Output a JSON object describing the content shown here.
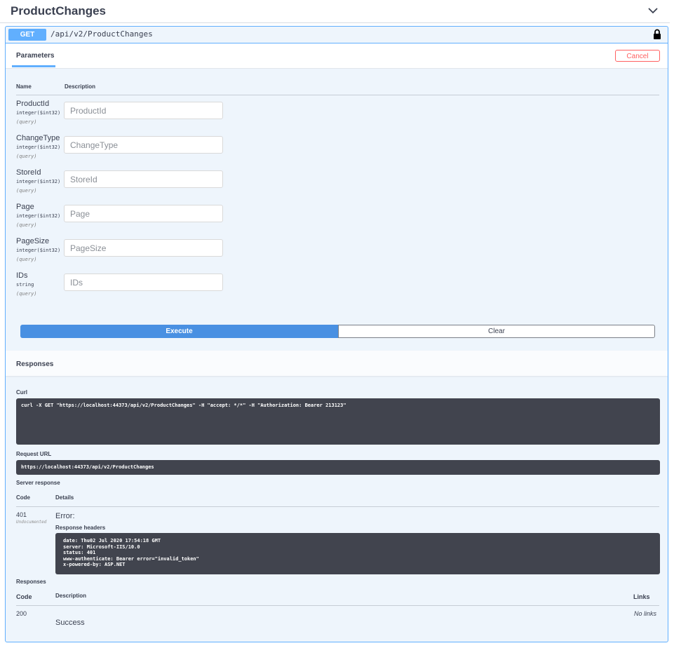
{
  "section": {
    "title": "ProductChanges"
  },
  "operation": {
    "method": "GET",
    "path": "/api/v2/ProductChanges"
  },
  "parameters": {
    "tab_label": "Parameters",
    "cancel_label": "Cancel",
    "col_name": "Name",
    "col_description": "Description",
    "items": [
      {
        "name": "ProductId",
        "type": "integer($int32)",
        "in": "(query)",
        "placeholder": "ProductId"
      },
      {
        "name": "ChangeType",
        "type": "integer($int32)",
        "in": "(query)",
        "placeholder": "ChangeType"
      },
      {
        "name": "StoreId",
        "type": "integer($int32)",
        "in": "(query)",
        "placeholder": "StoreId"
      },
      {
        "name": "Page",
        "type": "integer($int32)",
        "in": "(query)",
        "placeholder": "Page"
      },
      {
        "name": "PageSize",
        "type": "integer($int32)",
        "in": "(query)",
        "placeholder": "PageSize"
      },
      {
        "name": "IDs",
        "type": "string",
        "in": "(query)",
        "placeholder": "IDs"
      }
    ]
  },
  "actions": {
    "execute_label": "Execute",
    "clear_label": "Clear"
  },
  "responses": {
    "title": "Responses",
    "curl_label": "Curl",
    "curl_command": "curl -X GET \"https://localhost:44373/api/v2/ProductChanges\" -H \"accept: */*\" -H \"Authorization: Bearer 213123\"",
    "request_url_label": "Request URL",
    "request_url": "https://localhost:44373/api/v2/ProductChanges",
    "server_response_label": "Server response",
    "col_code": "Code",
    "col_details": "Details",
    "server_code": "401",
    "server_code_note": "Undocumented",
    "error_text": "Error:",
    "response_headers_label": "Response headers",
    "headers_text": "date: Thu02 Jul 2020 17:54:18 GMT\nserver: Microsoft-IIS/10.0\nstatus: 401\nwww-authenticate: Bearer error=\"invalid_token\"\nx-powered-by: ASP.NET",
    "documented_label": "Responses",
    "doc_col_code": "Code",
    "doc_col_description": "Description",
    "doc_col_links": "Links",
    "doc_code": "200",
    "doc_description": "Success",
    "doc_links": "No links"
  },
  "colors": {
    "get_blue": "#61affe",
    "execute_blue": "#4990e2",
    "cancel_red": "#ff6060",
    "code_bg": "#41444e"
  },
  "icons": {
    "collapse": "chevron-down-icon",
    "auth": "lock-icon"
  }
}
